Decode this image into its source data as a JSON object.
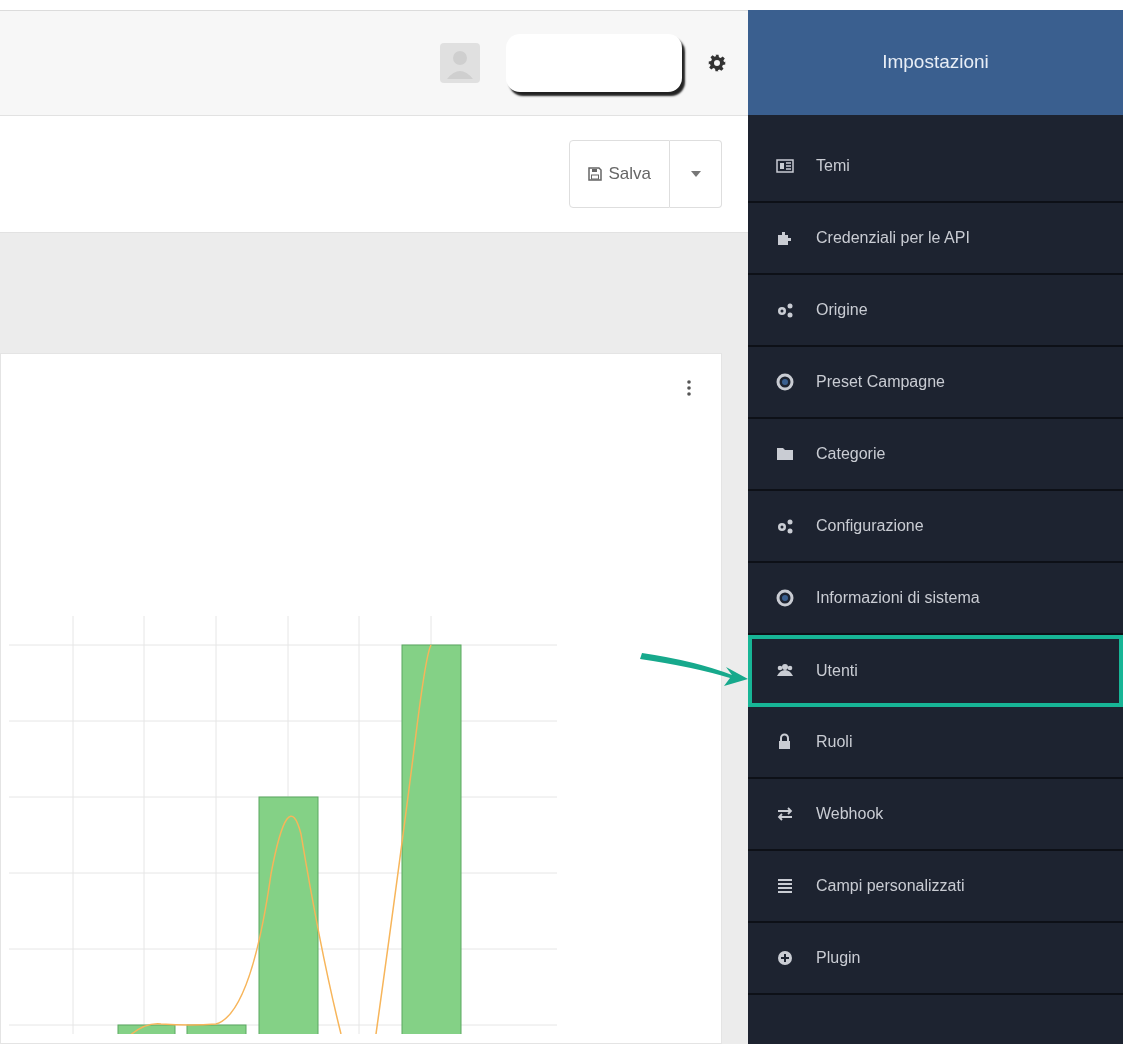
{
  "toolbar": {
    "save_button": "Salva"
  },
  "settings_panel": {
    "title": "Impostazioni",
    "items": [
      {
        "label": "Temi",
        "selected": false
      },
      {
        "label": "Credenziali per le API",
        "selected": false
      },
      {
        "label": "Origine",
        "selected": false
      },
      {
        "label": "Preset Campagne",
        "selected": false
      },
      {
        "label": "Categorie",
        "selected": false
      },
      {
        "label": "Configurazione",
        "selected": false
      },
      {
        "label": "Informazioni di sistema",
        "selected": false
      },
      {
        "label": "Utenti",
        "selected": true
      },
      {
        "label": "Ruoli",
        "selected": false
      },
      {
        "label": "Webhook",
        "selected": false
      },
      {
        "label": "Campi personalizzati",
        "selected": false
      },
      {
        "label": "Plugin",
        "selected": false
      }
    ]
  }
}
